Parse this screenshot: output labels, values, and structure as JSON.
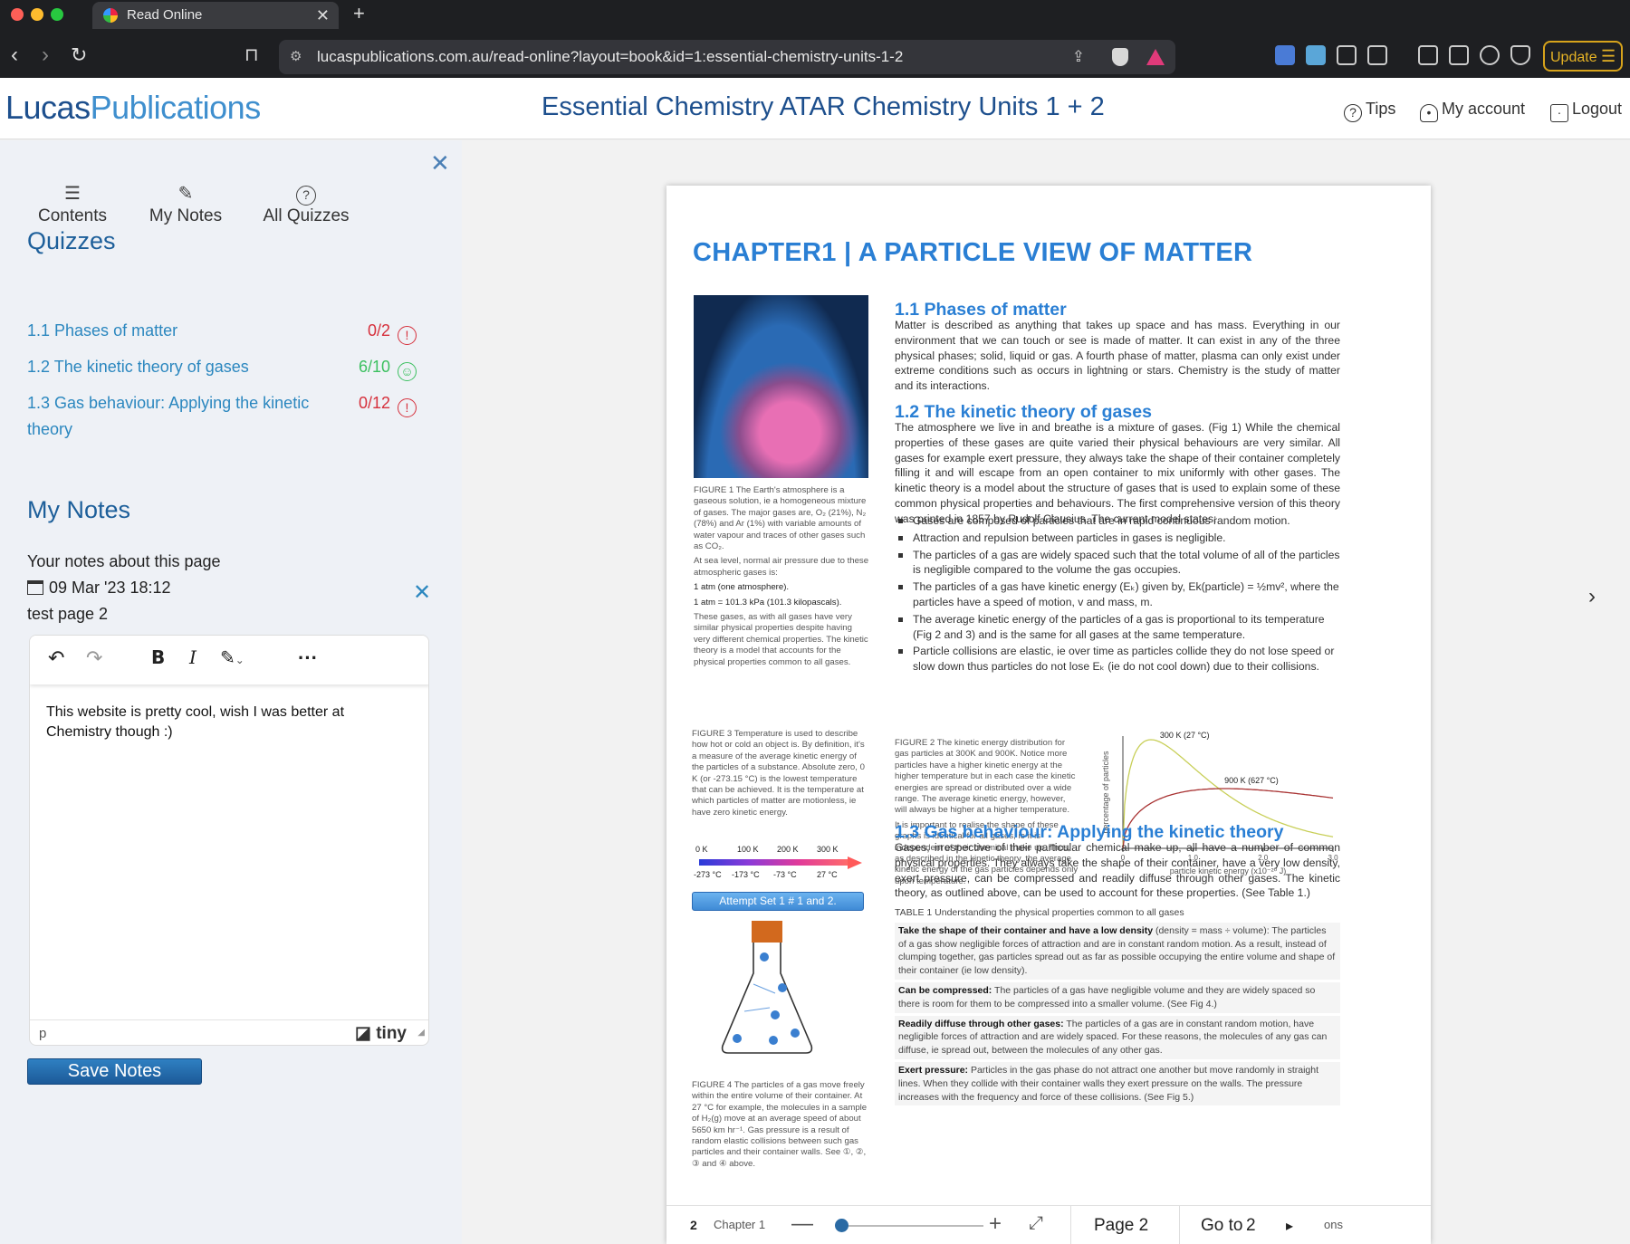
{
  "browser": {
    "tab_title": "Read Online",
    "url": "lucaspublications.com.au/read-online?layout=book&id=1:essential-chemistry-units-1-2",
    "update_label": "Update"
  },
  "header": {
    "logo_part1": "Lucas",
    "logo_part2": "Publications",
    "book_title": "Essential Chemistry ATAR Chemistry Units 1 + 2",
    "tips_label": "Tips",
    "account_label": "My account",
    "logout_label": "Logout"
  },
  "sidebar": {
    "tabs": [
      {
        "label": "Contents",
        "icon": "list-icon"
      },
      {
        "label": "My Notes",
        "icon": "pencil-icon"
      },
      {
        "label": "All Quizzes",
        "icon": "help-icon"
      }
    ],
    "quizzes_heading": "Quizzes",
    "quizzes": [
      {
        "title": "1.1 Phases of matter",
        "score": "0/2",
        "status": "!"
      },
      {
        "title": "1.2 The kinetic theory of gases",
        "score": "6/10",
        "status": "☺"
      },
      {
        "title": "1.3 Gas behaviour: Applying the kinetic theory",
        "score": "0/12",
        "status": "!"
      }
    ],
    "notes_heading": "My Notes",
    "notes_intro": "Your notes about this page",
    "note_date": "09 Mar '23 18:12",
    "note_title": "test page 2",
    "editor_text": "This website is pretty cool, wish I was better at Chemistry though :)",
    "editor_path": "p",
    "editor_brand": "tiny",
    "save_label": "Save Notes"
  },
  "page": {
    "chapter_title": "CHAPTER1 | A PARTICLE VIEW OF MATTER",
    "fig1_caption": "FIGURE 1 The Earth's atmosphere is a gaseous solution, ie a homogeneous mixture of gases. The major gases are, O₂ (21%), N₂ (78%) and Ar (1%) with variable amounts of water vapour and traces of other gases such as CO₂.",
    "fig1_extra1": "At sea level, normal air pressure due to these atmospheric gases is:",
    "fig1_extra2": "1 atm (one atmosphere).",
    "fig1_extra3": "1 atm = 101.3 kPa (101.3 kilopascals).",
    "fig1_extra4": "These gases, as with all gases have very similar physical properties despite having very different chemical properties. The kinetic theory is a model that accounts for the physical properties common to all gases.",
    "s1_title": "1.1 Phases of matter",
    "s1_text": "Matter is described as anything that takes up space and has mass. Everything in our environment that we can touch or see is made of matter. It can exist in any of the three physical phases; solid, liquid or gas. A fourth phase of matter, plasma can only exist under extreme conditions such as occurs in lightning or stars. Chemistry is the study of matter and its interactions.",
    "s2_title": "1.2 The kinetic theory of gases",
    "s2_text": "The atmosphere we live in and breathe is a mixture of gases. (Fig 1) While the chemical properties of these gases are quite varied their physical behaviours are very similar. All gases for example exert pressure, they always take the shape of their container completely filling it and will escape from an open container to mix uniformly with other gases. The kinetic theory is a model about the structure of gases that is used to explain some of these common physical properties and behaviours. The first comprehensive version of this theory was printed in 1857 by Rudolf Clausius. The current model states:",
    "bullets": [
      "Gases are composed of particles that are in rapid continuous random motion.",
      "Attraction and repulsion between particles in gases is negligible.",
      "The particles of a gas are widely spaced such that the total volume of all of the particles is negligible compared to the volume the gas occupies.",
      "The particles of a gas have kinetic energy (Eₖ) given by, Ek(particle) = ½mv², where the particles have a speed of motion, v and mass, m.",
      "The average kinetic energy of the particles of a gas is proportional to its temperature (Fig 2 and 3) and is the same for all gases at the same temperature.",
      "Particle collisions are elastic, ie over time as particles collide they do not lose speed or slow down thus particles do not lose Eₖ (ie do not cool down) due to their collisions."
    ],
    "fig3_caption": "FIGURE 3 Temperature is used to describe how hot or cold an object is. By definition, it's a measure of the average kinetic energy of the particles of a substance. Absolute zero, 0 K (or -273.15 °C) is the lowest temperature that can be achieved. It is the temperature at which particles of matter are motionless, ie have zero kinetic energy.",
    "temp_k": [
      "0 K",
      "100 K",
      "200 K",
      "300 K"
    ],
    "temp_c": [
      "-273 °C",
      "-173 °C",
      "-73 °C",
      "27 °C"
    ],
    "attempt_label": "Attempt Set 1 # 1 and 2.",
    "fig2_caption": "FIGURE 2 The kinetic energy distribution for gas particles at 300K and 900K. Notice more particles have a higher kinetic energy at the higher temperature but in each case the kinetic energies are spread or distributed over a wide range. The average kinetic energy, however, will always be higher at a higher temperature.",
    "fig2_extra": "It is important to realise the shape of these graphs is identical for all gases, ie it is independent of their chemical make up. Thus, as described in the kinetic theory, the average kinetic energy of the gas particles depends only upon temperature.",
    "s3_title": "1.3 Gas behaviour: Applying the kinetic theory",
    "s3_text": "Gases, irrespective of their particular chemical make up, all have a number of common physical properties. They always take the shape of their container, have a very low density, exert pressure, can be compressed and readily diffuse through other gases. The kinetic theory, as outlined above, can be used to account for these properties. (See Table 1.)",
    "table_caption": "TABLE 1 Understanding the physical properties common to all gases",
    "table_rows": [
      {
        "head": "Take the shape of their container and have a low density",
        "text": "(density = mass ÷ volume): The particles of a gas show negligible forces of attraction and are in constant random motion. As a result, instead of clumping together, gas particles spread out as far as possible occupying the entire volume and shape of their container (ie low density)."
      },
      {
        "head": "Can be compressed:",
        "text": "The particles of a gas have negligible volume and they are widely spaced so there is room for them to be compressed into a smaller volume. (See Fig 4.)"
      },
      {
        "head": "Readily diffuse through other gases:",
        "text": "The particles of a gas are in constant random motion, have negligible forces of attraction and are widely spaced. For these reasons, the molecules of any gas can diffuse, ie spread out, between the molecules of any other gas."
      },
      {
        "head": "Exert pressure:",
        "text": "Particles in the gas phase do not attract one another but move randomly in straight lines. When they collide with their container walls they exert pressure on the walls. The pressure increases with the frequency and force of these collisions. (See Fig 5.)"
      }
    ],
    "fig4_caption": "FIGURE 4 The particles of a gas move freely within the entire volume of their container. At 27 °C for example, the molecules in a sample of H₂(g) move at an average speed of about 5650 km hr⁻¹. Gas pressure is a result of random elastic collisions between such gas particles and their container walls. See ①, ②, ③ and ④ above.",
    "footer": {
      "page_num": "2",
      "chapter": "Chapter 1",
      "page_label": "Page 2",
      "goto_label": "Go to",
      "goto_value": "2",
      "ons": "ons"
    }
  },
  "chart_data": {
    "type": "line",
    "xlabel": "particle kinetic energy (x10⁻²⁰ J)",
    "ylabel": "percentage of particles",
    "x_ticks": [
      "0",
      "1.0",
      "2.0",
      "3.0"
    ],
    "xlim": [
      0,
      3.0
    ],
    "series": [
      {
        "name": "300 K (27 °C)",
        "color": "#c8cf58",
        "peak_x": 0.4
      },
      {
        "name": "900 K (627 °C)",
        "color": "#a83232",
        "peak_x": 1.45
      }
    ]
  }
}
